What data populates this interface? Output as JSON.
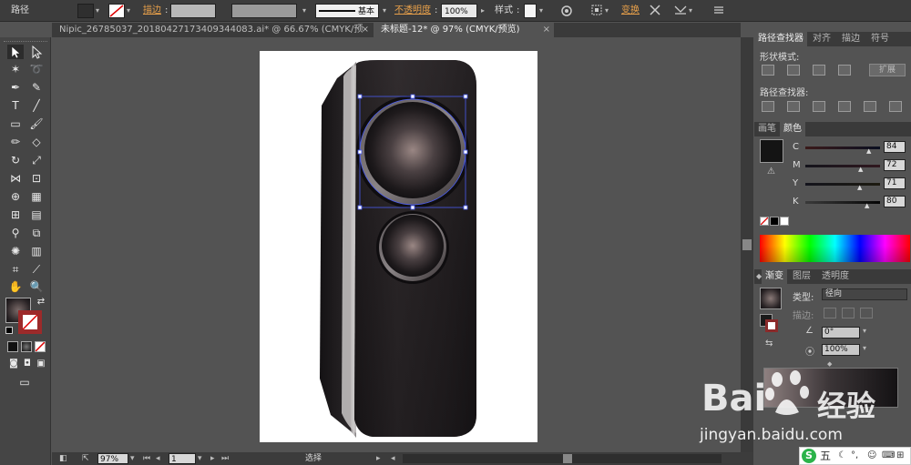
{
  "control": {
    "object_type": "路径",
    "stroke_label": "描边",
    "stroke_style": "基本",
    "opacity_label": "不透明度",
    "opacity_value": "100%",
    "style_label": "样式",
    "transform_label": "变换"
  },
  "tabs": [
    {
      "label": "Nipic_26785037_20180427173409344083.ai* @ 66.67% (CMYK/预览)",
      "close": "×"
    },
    {
      "label": "未标题-12* @ 97% (CMYK/预览)",
      "close": "×"
    }
  ],
  "status": {
    "zoom": "97%",
    "page": "1",
    "mode": "选择"
  },
  "panels": {
    "pathfinder": {
      "tabs": [
        "路径查找器",
        "对齐",
        "描边",
        "符号"
      ],
      "shape_modes_label": "形状模式:",
      "expand_label": "扩展",
      "pathfinders_label": "路径查找器:"
    },
    "color": {
      "tabs": [
        "画笔",
        "颜色"
      ],
      "channels": [
        {
          "name": "C",
          "value": "84",
          "fraction": 0.84
        },
        {
          "name": "M",
          "value": "72",
          "fraction": 0.72
        },
        {
          "name": "Y",
          "value": "71",
          "fraction": 0.71
        },
        {
          "name": "K",
          "value": "80",
          "fraction": 0.8
        }
      ]
    },
    "gradient": {
      "tabs": [
        "渐变",
        "图层",
        "透明度"
      ],
      "type_label": "类型:",
      "type_value": "径向",
      "stroke_label": "描边:",
      "angle_value": "0°",
      "aspect_value": "100%"
    }
  },
  "watermark": {
    "brand": "Bai",
    "brand2": "经验",
    "url": "jingyan.baidu.com"
  },
  "ime": {
    "label": "五"
  },
  "colors": {
    "app_bg": "#535353",
    "panel_dark": "#3c3c3c",
    "accent_orange": "#e8a04a",
    "speaker_body": "#1a1719",
    "fill_swatch": "#141414"
  }
}
